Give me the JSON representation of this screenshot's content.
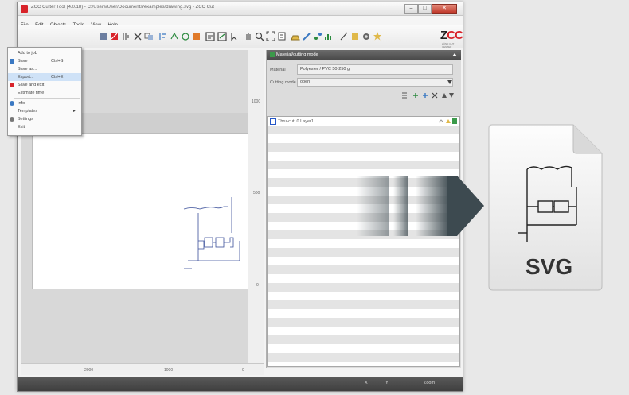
{
  "window": {
    "title": "ZCC Cutter Tool (4.0.18) - C:/Users/User/Documents/examples/drawing.svg - ZCC Cut",
    "controls": {
      "minimize": "–",
      "maximize": "□",
      "close": "✕"
    }
  },
  "menubar": [
    "File",
    "Edit",
    "Objects",
    "Tools",
    "View",
    "Help"
  ],
  "file_menu": {
    "items": [
      {
        "label": "Add to job",
        "shortcut": ""
      },
      {
        "label": "Save",
        "shortcut": "Ctrl+S"
      },
      {
        "label": "Save as...",
        "shortcut": ""
      },
      {
        "label": "Export...",
        "shortcut": "Ctrl+E"
      },
      {
        "label": "Save and exit",
        "shortcut": ""
      },
      {
        "label": "Estimate time",
        "shortcut": ""
      },
      {
        "label": "Info",
        "shortcut": ""
      },
      {
        "label": "Templates",
        "shortcut": "▸"
      },
      {
        "label": "Settings",
        "shortcut": ""
      },
      {
        "label": "Exit",
        "shortcut": ""
      }
    ]
  },
  "logo": {
    "text_z": "Z",
    "text_cc": "CC",
    "sub": "ZÜND CUT CENTER"
  },
  "rulers": {
    "horizontal": [
      "2000",
      "1000",
      "0"
    ],
    "vertical": [
      "1000",
      "500",
      "0"
    ]
  },
  "panel": {
    "title": "Material/cutting mode",
    "material_label": "Material",
    "material_value": "Polyester / PVC 50-250 g",
    "cutting_mode_label": "Cutting mode",
    "cutting_mode_value": "open",
    "layer_label": "Thru-cut: 0 Layer1"
  },
  "statusbar": {
    "x_label": "X",
    "y_label": "Y",
    "zoom_label": "Zoom"
  },
  "export_graphic": {
    "label": "SVG"
  },
  "colors": {
    "accent_red": "#d8232a",
    "panel_dark": "#4a4a4a",
    "arrow": "#3d4a50",
    "highlight": "#cfe2f7"
  }
}
